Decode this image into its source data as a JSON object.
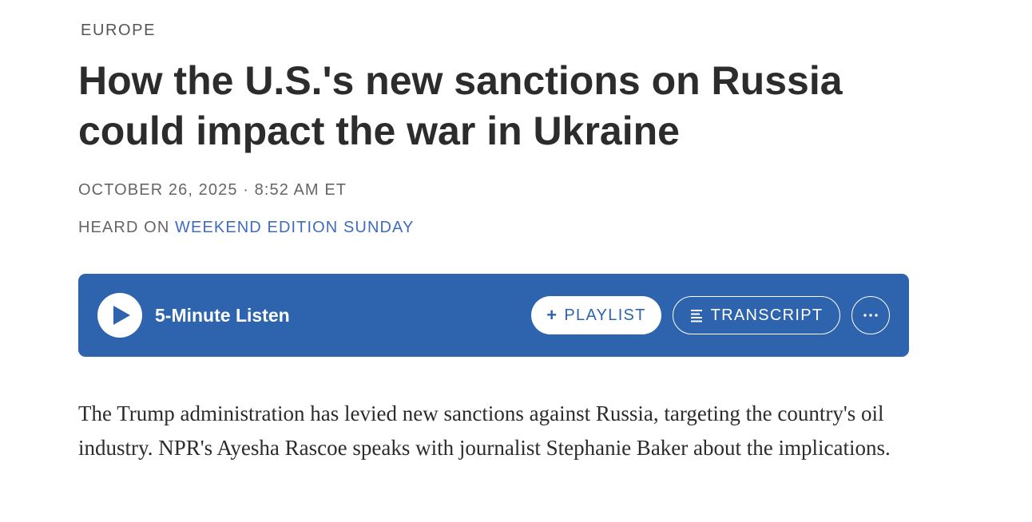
{
  "article": {
    "section": "EUROPE",
    "headline": "How the U.S.'s new sanctions on Russia could impact the war in Ukraine",
    "dateline": "OCTOBER 26, 2025 · 8:52 AM ET",
    "heard_on_prefix": "HEARD ON ",
    "heard_on_program": "WEEKEND EDITION SUNDAY",
    "teaser": "The Trump administration has levied new sanctions against Russia, targeting the country's oil industry. NPR's Ayesha Rascoe speaks with journalist Stephanie Baker about the implications."
  },
  "player": {
    "listen_label": "5-Minute Listen",
    "playlist_plus": "+",
    "playlist_label": "PLAYLIST",
    "transcript_label": "TRANSCRIPT",
    "play_icon": "play-icon",
    "transcript_icon": "transcript-lines-icon",
    "more_icon": "more-dots-icon"
  },
  "colors": {
    "player_background": "#2e64ad",
    "link": "#3f6cbe",
    "headline": "#2c2c2c",
    "meta": "#666666"
  }
}
